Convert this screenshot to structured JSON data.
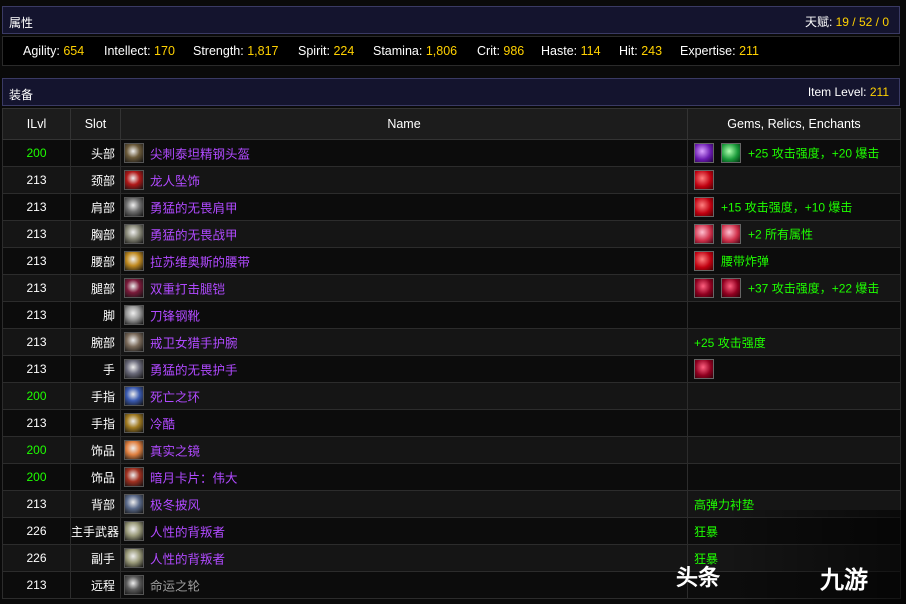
{
  "attributes": {
    "title": "属性",
    "talent_label": "天赋:",
    "talent_value": "19 / 52 / 0",
    "stats": [
      {
        "label": "Agility:",
        "value": "654"
      },
      {
        "label": "Intellect:",
        "value": "170"
      },
      {
        "label": "Strength:",
        "value": "1,817"
      },
      {
        "label": "Spirit:",
        "value": "224"
      },
      {
        "label": "Stamina:",
        "value": "1,806"
      },
      {
        "label": "Crit:",
        "value": "986"
      },
      {
        "label": "Haste:",
        "value": "114"
      },
      {
        "label": "Hit:",
        "value": "243"
      },
      {
        "label": "Expertise:",
        "value": "211"
      }
    ]
  },
  "equipment": {
    "title": "装备",
    "item_level_label": "Item Level:",
    "item_level_value": "211",
    "columns": [
      "ILvl",
      "Slot",
      "Name",
      "Gems, Relics, Enchants"
    ],
    "rows": [
      {
        "ilvl": "200",
        "slot": "头部",
        "name": "尖刺泰坦精钢头盔",
        "icon_color": "#6b5a3a",
        "gems": [
          "purple",
          "green"
        ],
        "enchant": "+25 攻击强度，+20 爆击"
      },
      {
        "ilvl": "213",
        "slot": "颈部",
        "name": "龙人坠饰",
        "icon_color": "#b01818",
        "gems": [
          "red"
        ],
        "enchant": ""
      },
      {
        "ilvl": "213",
        "slot": "肩部",
        "name": "勇猛的无畏肩甲",
        "icon_color": "#707070",
        "gems": [
          "red"
        ],
        "enchant": "+15 攻击强度，+10 爆击"
      },
      {
        "ilvl": "213",
        "slot": "胸部",
        "name": "勇猛的无畏战甲",
        "icon_color": "#8a8a7a",
        "gems": [
          "pink",
          "pink"
        ],
        "enchant": "+2 所有属性"
      },
      {
        "ilvl": "213",
        "slot": "腰部",
        "name": "拉苏维奥斯的腰带",
        "icon_color": "#c08a20",
        "gems": [
          "red"
        ],
        "enchant": "腰带炸弹"
      },
      {
        "ilvl": "213",
        "slot": "腿部",
        "name": "双重打击腿铠",
        "icon_color": "#7a1a3a",
        "gems": [
          "oval",
          "oval"
        ],
        "enchant": "+37 攻击强度，+22 爆击"
      },
      {
        "ilvl": "213",
        "slot": "脚",
        "name": "刀锋钢靴",
        "icon_color": "#9a9a9a",
        "gems": [],
        "enchant": ""
      },
      {
        "ilvl": "213",
        "slot": "腕部",
        "name": "戒卫女猎手护腕",
        "icon_color": "#7a6a5a",
        "gems": [],
        "enchant": "+25 攻击强度"
      },
      {
        "ilvl": "213",
        "slot": "手",
        "name": "勇猛的无畏护手",
        "icon_color": "#6a6a7a",
        "gems": [
          "oval"
        ],
        "enchant": ""
      },
      {
        "ilvl": "200",
        "slot": "手指",
        "name": "死亡之环",
        "icon_color": "#3a5ab0",
        "gems": [],
        "enchant": ""
      },
      {
        "ilvl": "213",
        "slot": "手指",
        "name": "冷酷",
        "icon_color": "#a07a20",
        "gems": [],
        "enchant": ""
      },
      {
        "ilvl": "200",
        "slot": "饰品",
        "name": "真实之镜",
        "icon_color": "#e08040",
        "gems": [],
        "enchant": ""
      },
      {
        "ilvl": "200",
        "slot": "饰品",
        "name": "暗月卡片：伟大",
        "icon_color": "#a03020",
        "gems": [],
        "enchant": ""
      },
      {
        "ilvl": "213",
        "slot": "背部",
        "name": "极冬披风",
        "icon_color": "#5a6a8a",
        "gems": [],
        "enchant": "高弹力衬垫"
      },
      {
        "ilvl": "226",
        "slot": "主手武器",
        "name": "人性的背叛者",
        "icon_color": "#9a9a7a",
        "gems": [],
        "enchant": "狂暴"
      },
      {
        "ilvl": "226",
        "slot": "副手",
        "name": "人性的背叛者",
        "icon_color": "#9a9a7a",
        "gems": [],
        "enchant": "狂暴"
      },
      {
        "ilvl": "213",
        "slot": "远程",
        "name": "命运之轮",
        "icon_color": "#5a5a5a",
        "gems": [],
        "enchant": ""
      }
    ]
  },
  "watermarks": [
    "头条",
    "九游"
  ]
}
